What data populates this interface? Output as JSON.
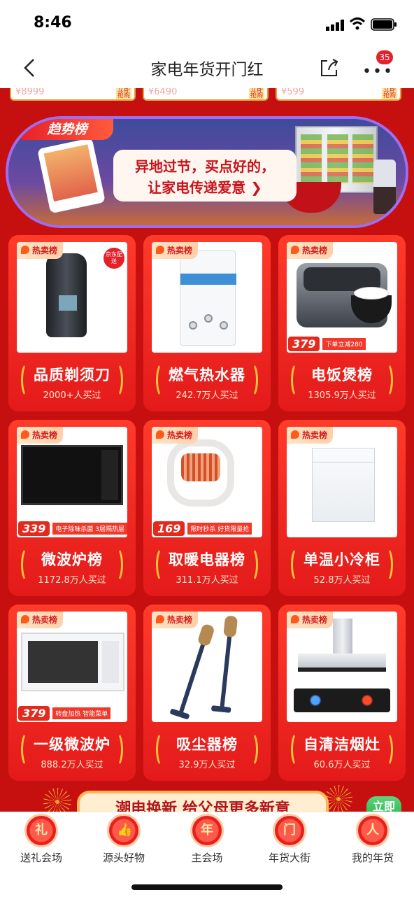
{
  "status": {
    "time": "8:46"
  },
  "nav": {
    "title": "家电年货开门红",
    "badge": "35"
  },
  "top_strip": {
    "items": [
      {
        "price": "¥8999",
        "tag": "立即抢购"
      },
      {
        "price": "¥6490",
        "tag": "立即抢购"
      },
      {
        "price": "¥599",
        "tag": "立即抢购"
      }
    ]
  },
  "banner": {
    "tag": "趋势榜",
    "line1": "异地过节，买点好的，",
    "line2": "让家电传递爱意 ❯"
  },
  "hot_label": "热卖榜",
  "cards": [
    {
      "name": "品质剃须刀",
      "bought": "2000+人买过",
      "sticker": "京东配送",
      "price": ""
    },
    {
      "name": "燃气热水器",
      "bought": "242.7万人买过",
      "price": ""
    },
    {
      "name": "电饭煲榜",
      "bought": "1305.9万人买过",
      "price": "379",
      "promo": "下单立减280"
    },
    {
      "name": "微波炉榜",
      "bought": "1172.8万人买过",
      "price": "339",
      "promo": "电子除味杀菌 3层隔热层"
    },
    {
      "name": "取暖电器榜",
      "bought": "311.1万人买过",
      "price": "169",
      "promo": "限时秒杀 好货限量抢"
    },
    {
      "name": "单温小冷柜",
      "bought": "52.8万人买过",
      "price": ""
    },
    {
      "name": "一级微波炉",
      "bought": "888.2万人买过",
      "price": "379",
      "promo": "转盘加热 智能菜单"
    },
    {
      "name": "吸尘器榜",
      "bought": "32.9万人买过",
      "price": ""
    },
    {
      "name": "自清洁烟灶",
      "bought": "60.6万人买过",
      "price": ""
    }
  ],
  "bottom_banner": {
    "text": "潮电换新 给父母更多新意"
  },
  "float_button": {
    "label": "立即"
  },
  "tabs": [
    {
      "label": "送礼会场",
      "glyph": "礼"
    },
    {
      "label": "源头好物",
      "glyph": "👍"
    },
    {
      "label": "主会场",
      "glyph": "年"
    },
    {
      "label": "年货大街",
      "glyph": "门"
    },
    {
      "label": "我的年货",
      "glyph": "人"
    }
  ]
}
